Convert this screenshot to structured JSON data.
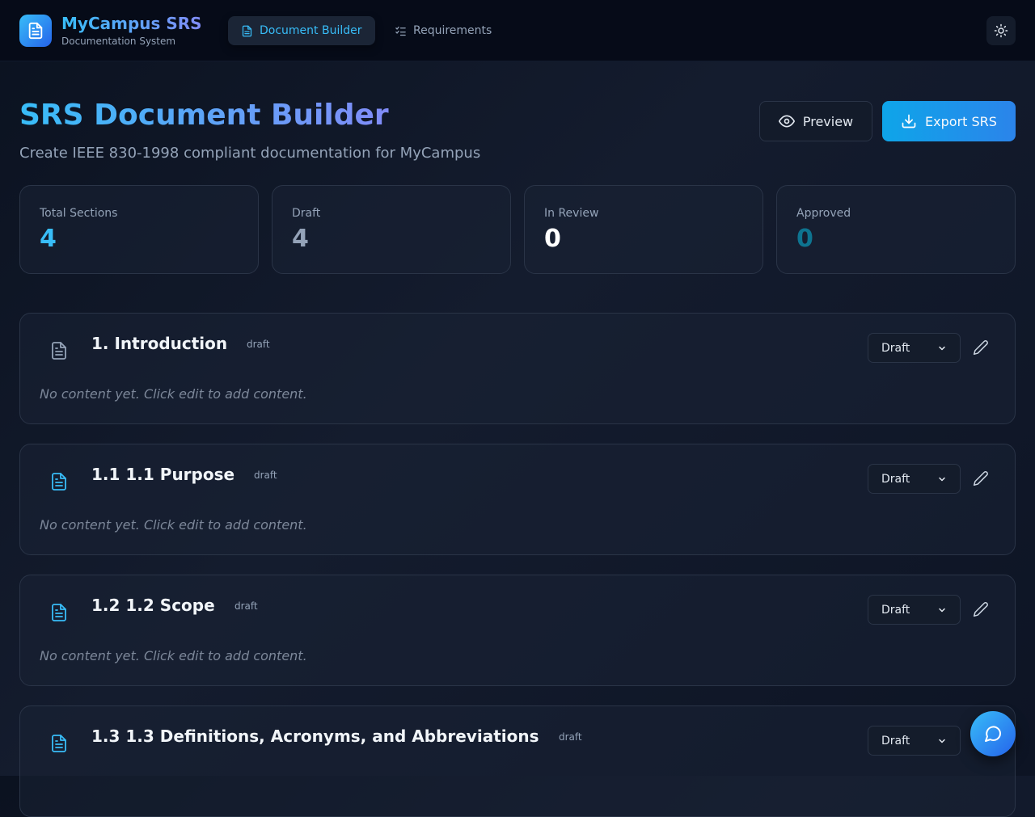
{
  "header": {
    "app_title": "MyCampus SRS",
    "app_subtitle": "Documentation System",
    "logo_icon": "document-icon",
    "tabs": [
      {
        "label": "Document Builder",
        "icon": "document-icon",
        "active": true
      },
      {
        "label": "Requirements",
        "icon": "checklist-icon",
        "active": false
      }
    ],
    "theme_icon": "sun-icon"
  },
  "page": {
    "title": "SRS Document Builder",
    "subtitle": "Create IEEE 830-1998 compliant documentation for MyCampus",
    "preview_label": "Preview",
    "export_label": "Export SRS"
  },
  "stats": [
    {
      "label": "Total Sections",
      "value": "4",
      "color": "#38bdf8"
    },
    {
      "label": "Draft",
      "value": "4",
      "color": "#94a3b8"
    },
    {
      "label": "In Review",
      "value": "0",
      "color": "#ffffff"
    },
    {
      "label": "Approved",
      "value": "0",
      "color": "#0e7490"
    }
  ],
  "sections": [
    {
      "title": "1. Introduction",
      "badge": "draft",
      "status": "Draft",
      "content": "No content yet. Click edit to add content.",
      "icon_color": "#94a3b8"
    },
    {
      "title": "1.1 1.1 Purpose",
      "badge": "draft",
      "status": "Draft",
      "content": "No content yet. Click edit to add content.",
      "icon_color": "#38bdf8"
    },
    {
      "title": "1.2 1.2 Scope",
      "badge": "draft",
      "status": "Draft",
      "content": "No content yet. Click edit to add content.",
      "icon_color": "#38bdf8"
    },
    {
      "title": "1.3 1.3 Definitions, Acronyms, and Abbreviations",
      "badge": "draft",
      "status": "Draft",
      "content": "",
      "icon_color": "#38bdf8"
    }
  ],
  "colors": {
    "accent": "#38bdf8",
    "accent_secondary": "#818cf8",
    "background": "#0b1220"
  },
  "chat_icon": "chat-bubble-icon"
}
